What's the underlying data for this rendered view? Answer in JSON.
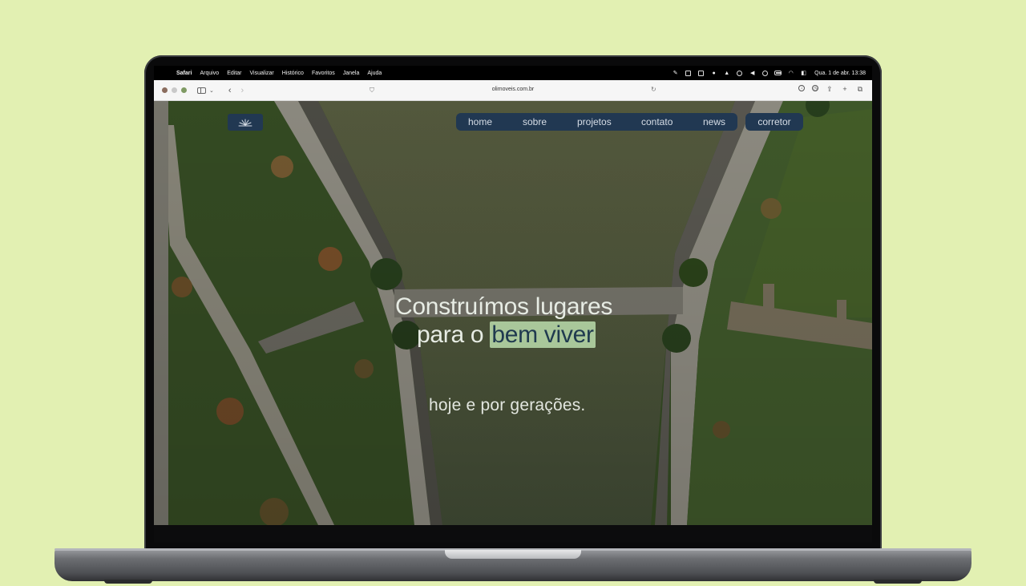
{
  "menubar": {
    "apple_icon": "apple-logo-icon",
    "items": [
      "Safari",
      "Arquivo",
      "Editar",
      "Visualizar",
      "Histórico",
      "Favoritos",
      "Janela",
      "Ajuda"
    ],
    "clock": "Qua. 1 de abr.  13:38"
  },
  "browser": {
    "url": "olimoveis.com.br",
    "colors": {
      "close": "#8b6d5e",
      "minimize": "#c9c9c9",
      "zoom": "#7f9a63"
    }
  },
  "site": {
    "nav": [
      "home",
      "sobre",
      "projetos",
      "contato",
      "news"
    ],
    "corretor_label": "corretor",
    "headline_line1": "Construímos lugares",
    "headline_line2_prefix": "para o ",
    "headline_highlight": "bem viver",
    "subline": "hoje e por gerações.",
    "colors": {
      "nav_bg": "#213852",
      "highlight": "#a9c79a",
      "page_bg": "#e2f0b2"
    }
  }
}
